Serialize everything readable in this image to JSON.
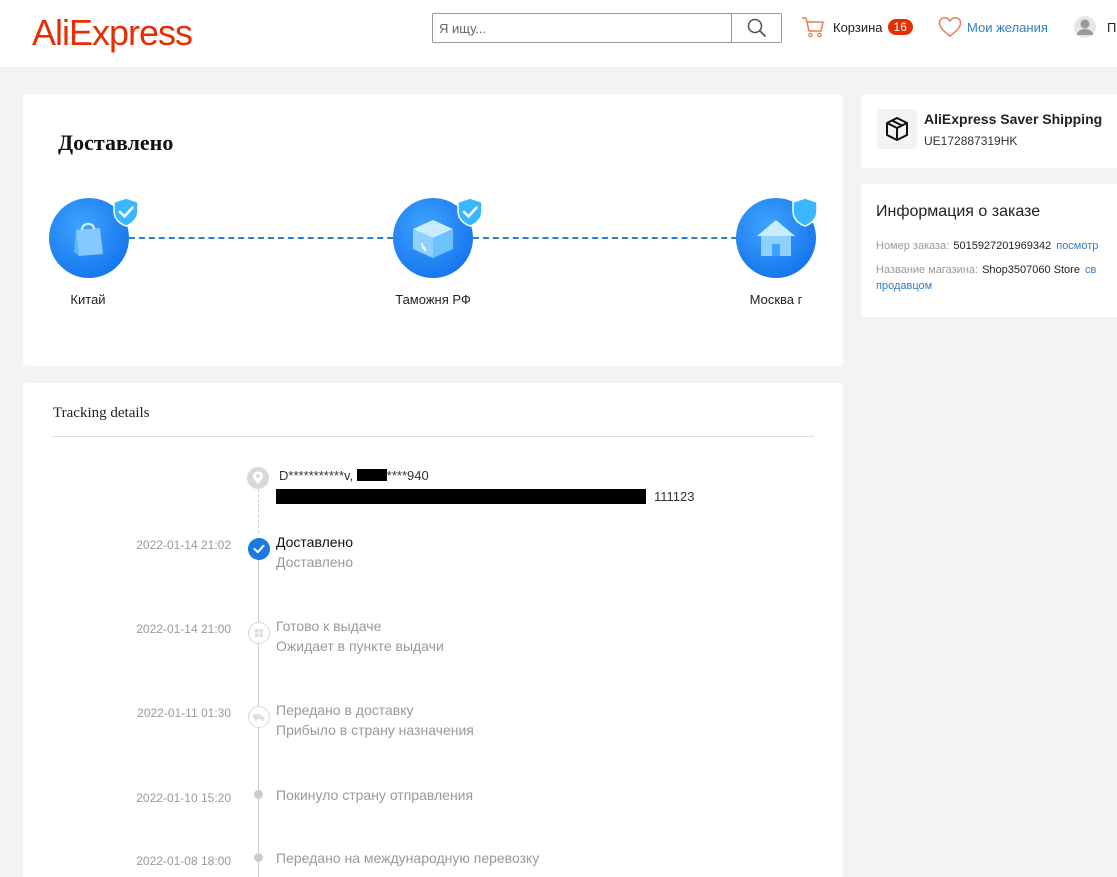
{
  "header": {
    "logo": "AliExpress",
    "search_placeholder": "Я ищу...",
    "cart_label": "Корзина",
    "cart_count": "16",
    "wishlist_label": "Мои желания",
    "user_label": "П"
  },
  "status": {
    "title": "Доставлено",
    "route": [
      {
        "label": "Китай",
        "icon": "bag-icon"
      },
      {
        "label": "Таможня РФ",
        "icon": "customs-box-icon"
      },
      {
        "label": "Москва г",
        "icon": "house-icon"
      }
    ]
  },
  "tracking": {
    "title": "Tracking details",
    "address_name_start": "D***********v, ",
    "address_phone_end": "****940",
    "address_zip": "111123",
    "events": [
      {
        "date": "2022-01-14 21:02",
        "title": "Доставлено",
        "desc": "Доставлено",
        "state": "done"
      },
      {
        "date": "2022-01-14 21:00",
        "title": "Готово к выдаче",
        "desc": "Ожидает в пункте выдачи",
        "state": "pickup"
      },
      {
        "date": "2022-01-11 01:30",
        "title": "Передано в доставку",
        "desc": "Прибыло в страну назначения",
        "state": "transit"
      },
      {
        "date": "2022-01-10 15:20",
        "title": "Покинуло страну отправления",
        "desc": "",
        "state": "minor"
      },
      {
        "date": "2022-01-08 18:00",
        "title": "Передано на международную перевозку",
        "desc": "",
        "state": "minor"
      }
    ]
  },
  "shipping": {
    "service": "AliExpress Saver Shipping",
    "tracking_number": "UE172887319HK"
  },
  "order_info": {
    "title": "Информация о заказе",
    "order_number_label": "Номер заказа:",
    "order_number": "5015927201969342",
    "order_link": "посмотр",
    "store_label": "Название магазина:",
    "store_name": "Shop3507060 Store",
    "contact_link_start": "св",
    "contact_link_end": "продавцом"
  },
  "colors": {
    "brand": "#e62e04",
    "link": "#2f80c8",
    "progress": "#1a7ae0"
  }
}
